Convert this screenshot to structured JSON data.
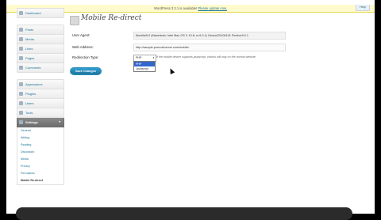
{
  "notice": {
    "text": "WordPress 3.3.1 is available!",
    "link": "Please update now."
  },
  "help_tab": "Help",
  "sidebar": {
    "dashboard": "Dashboard",
    "group1": [
      "Posts",
      "Media",
      "Links",
      "Pages",
      "Comments"
    ],
    "group2": [
      "Appearance",
      "Plugins",
      "Users",
      "Tools"
    ],
    "settings": "Settings",
    "submenu": [
      "General",
      "Writing",
      "Reading",
      "Discussion",
      "Media",
      "Privacy",
      "Permalinks",
      "Mobile Re-direct"
    ]
  },
  "page": {
    "title": "Mobile Re-direct",
    "user_agent_label": "User Agent:",
    "user_agent_value": "Mozilla/5.0 (Macintosh; Intel Mac OS X 10.6; rv:9.0.1) Gecko/20100101 Firefox/9.0.1",
    "web_address_label": "Web Address:",
    "web_address_value": "http://sample.promotiozone.com/mobile/",
    "redirection_label": "Redirection Type:",
    "redirection_selected": "PHP",
    "redirection_options": [
      "PHP",
      "Javascript"
    ],
    "redirection_hint": "If the mobile device supports javascript, visitors will stay on the normal website",
    "save_label": "Save Changes"
  }
}
